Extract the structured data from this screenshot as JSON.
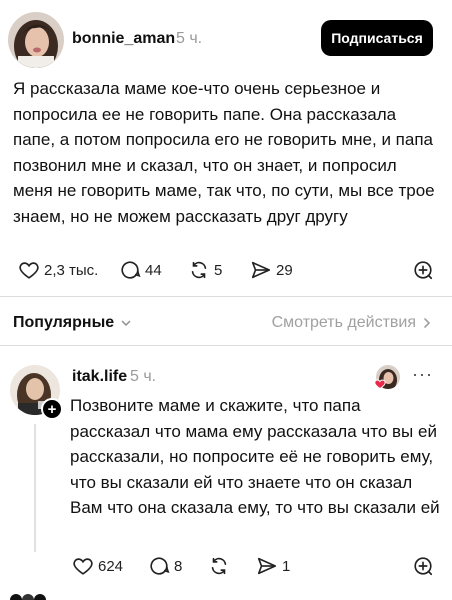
{
  "post": {
    "username": "bonnie_aman",
    "time": "5 ч.",
    "follow_label": "Подписаться",
    "text": "Я рассказала маме кое-что очень серьезное и попросила ее не говорить папе. Она рассказала папе, а потом попросила его не говорить мне, и папа позвонил мне и сказал, что он знает, и попросил меня не говорить маме, так что, по сути, мы все трое знаем, но не можем рассказать друг другу",
    "likes": "2,3 тыс.",
    "comments": "44",
    "reposts": "5",
    "shares": "29"
  },
  "replies_header": {
    "sort_label": "Популярные",
    "view_actions_label": "Смотреть действия"
  },
  "reply": {
    "username": "itak.life",
    "time": "5 ч.",
    "more_label": "···",
    "text": "Позвоните маме и скажите, что папа рассказал что мама ему рассказала что вы ей рассказали, но попросите её не говорить ему, что вы сказали ей что знаете что он сказал Вам что она сказала ему, то что вы сказали ей",
    "likes": "624",
    "comments": "8",
    "shares": "1"
  },
  "colors": {
    "follow_button_bg": "#000000",
    "secondary_text": "#9a9a9a",
    "liked_heart": "#e8294a"
  }
}
